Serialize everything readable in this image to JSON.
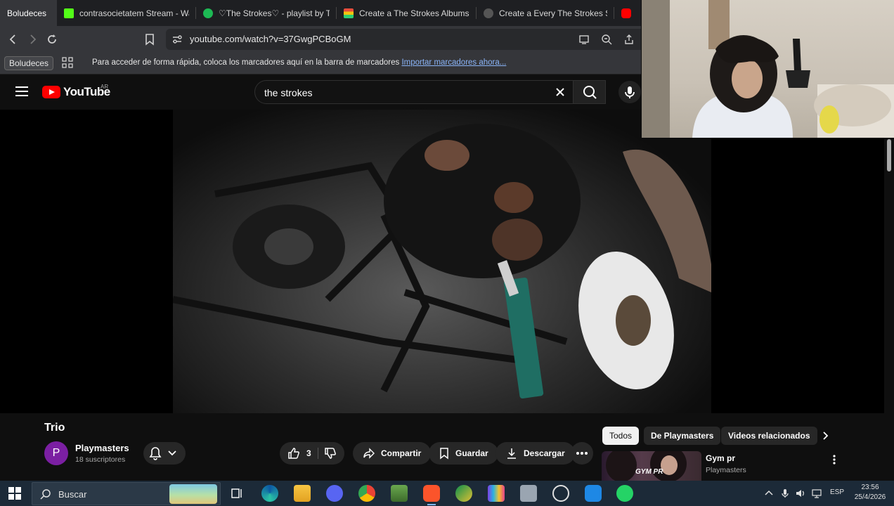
{
  "browser": {
    "tabs": [
      {
        "title": "Boludeces",
        "active": true
      },
      {
        "title": "contrasocietatem Stream - Wat",
        "favicon": "kick-favicon"
      },
      {
        "title": "♡The Strokes♡ - playlist by T",
        "favicon": "spotify-favicon"
      },
      {
        "title": "Create a The Strokes Albums (i",
        "favicon": "tiermaker-favicon"
      },
      {
        "title": "Create a Every The Strokes Son",
        "favicon": "tiermaker-favicon"
      },
      {
        "title": "",
        "favicon": "youtube-favicon"
      }
    ],
    "url": "youtube.com/watch?v=37GwgPCBoGM",
    "bookmarks": {
      "folder": "Boludeces",
      "message": "Para acceder de forma rápida, coloca los marcadores aquí en la barra de marcadores",
      "import_link": "Importar marcadores ahora..."
    }
  },
  "youtube": {
    "logo_text": "YouTube",
    "country": "AR",
    "search_query": "the strokes",
    "video": {
      "title": "Trio",
      "channel": "Playmasters",
      "channel_initial": "P",
      "subscribers": "18 suscriptores",
      "likes": "3",
      "share_label": "Compartir",
      "save_label": "Guardar",
      "download_label": "Descargar"
    },
    "chips": [
      "Todos",
      "De Playmasters",
      "Videos relacionados"
    ],
    "recommendation": {
      "title": "Gym pr",
      "channel": "Playmasters",
      "thumb_text": "GYM PR"
    }
  },
  "taskbar": {
    "search_placeholder": "Buscar",
    "language": "ESP",
    "time": "23:56",
    "date": "25/4/2026"
  },
  "colors": {
    "youtube_red": "#ff0000",
    "link_blue": "#8ab4f8",
    "avatar_purple": "#7b1fa2"
  }
}
